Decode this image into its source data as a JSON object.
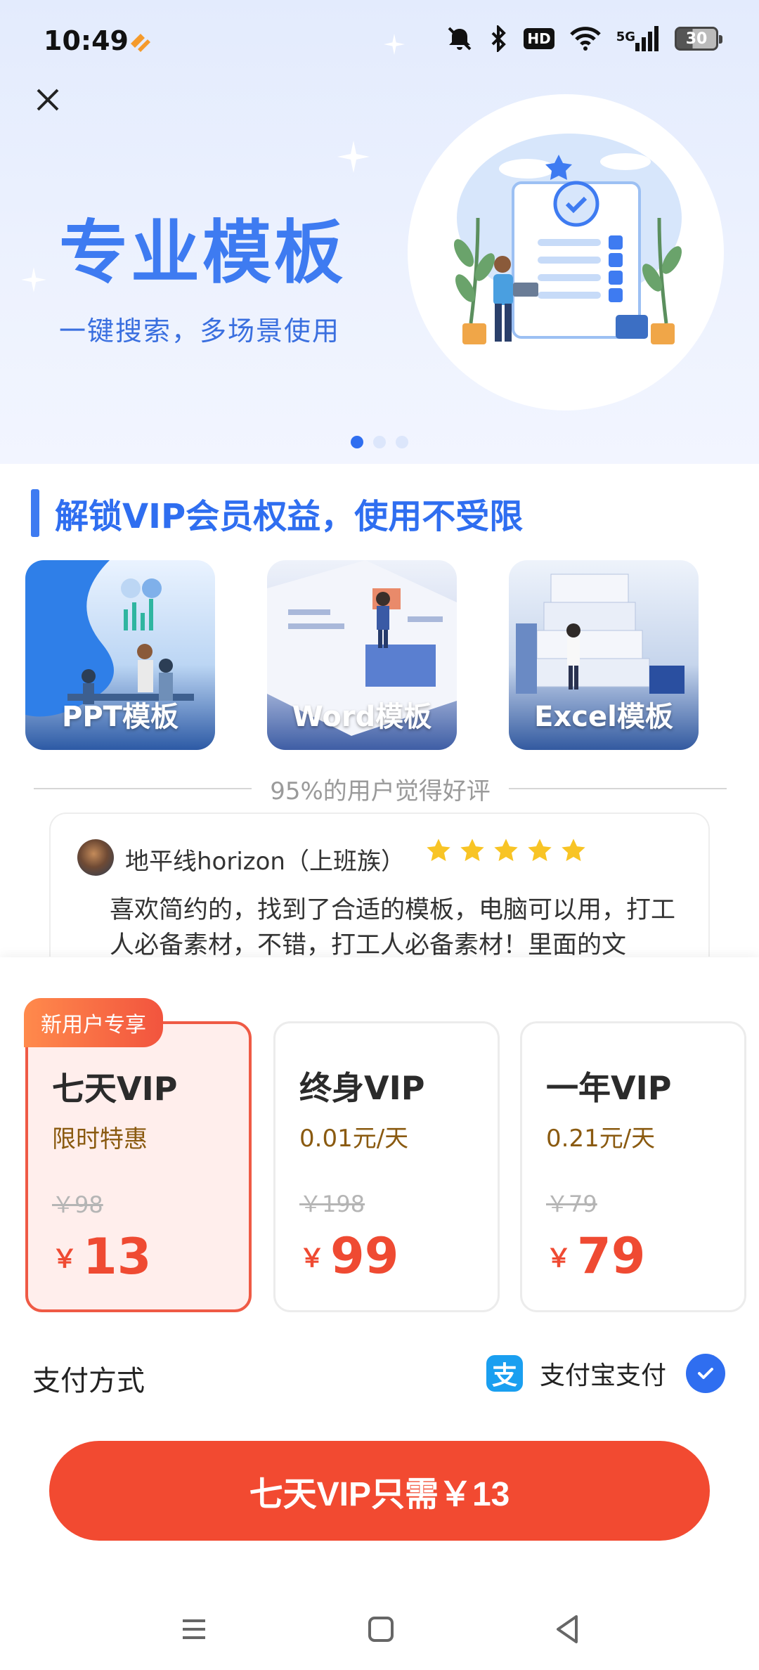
{
  "status_bar": {
    "time": "10:49",
    "network": "5G",
    "battery": "30"
  },
  "hero": {
    "title": "专业模板",
    "subtitle": "一键搜索，多场景使用",
    "page_indicator": {
      "count": 3,
      "active": 0
    }
  },
  "section": {
    "title": "解锁VIP会员权益，使用不受限"
  },
  "templates": [
    {
      "label": "PPT模板"
    },
    {
      "label": "Word模板"
    },
    {
      "label": "Excel模板"
    }
  ],
  "rating": {
    "text": "95%的用户觉得好评"
  },
  "review": {
    "user": "地平线horizon（上班族）",
    "stars": 5,
    "text": "喜欢简约的，找到了合适的模板，电脑可以用，打工人必备素材，不错，打工人必备素材！里面的文"
  },
  "plans": {
    "badge": "新用户专享",
    "items": [
      {
        "name": "七天VIP",
        "sub": "限时特惠",
        "original": "￥98",
        "currency": "￥",
        "price": "13",
        "selected": true
      },
      {
        "name": "终身VIP",
        "sub": "0.01元/天",
        "original": "￥198",
        "currency": "￥",
        "price": "99",
        "selected": false
      },
      {
        "name": "一年VIP",
        "sub": "0.21元/天",
        "original": "￥79",
        "currency": "￥",
        "price": "79",
        "selected": false
      }
    ]
  },
  "payment": {
    "label": "支付方式",
    "method": "支付宝支付",
    "method_icon_text": "支"
  },
  "cta": {
    "label": "七天VIP只需￥13"
  },
  "colors": {
    "primary_blue": "#2f6ef0",
    "accent_red": "#f24a31",
    "selected_bg": "#ffeeec"
  }
}
